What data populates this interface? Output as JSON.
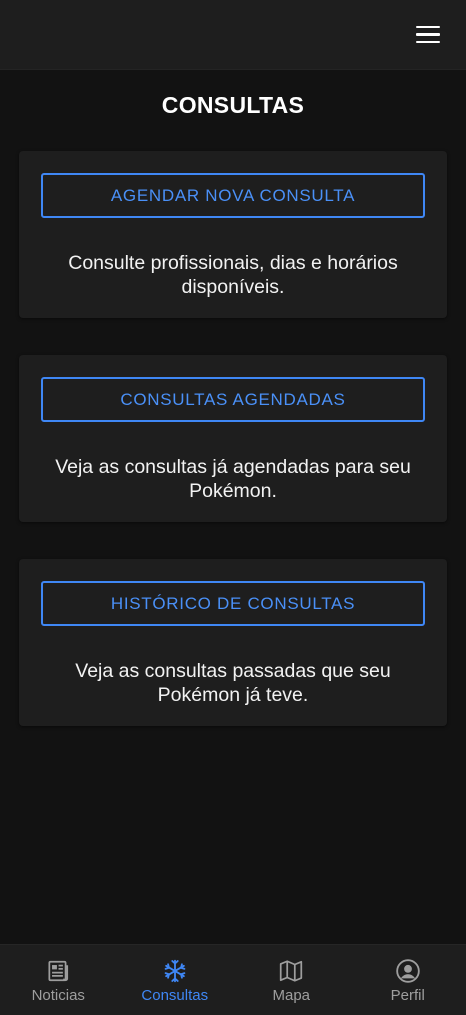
{
  "header": {
    "menu_icon": "hamburger-menu-icon"
  },
  "page": {
    "title": "CONSULTAS"
  },
  "cards": [
    {
      "button_label": "AGENDAR NOVA CONSULTA",
      "description": "Consulte profissionais, dias e horários disponíveis."
    },
    {
      "button_label": "CONSULTAS AGENDADAS",
      "description": "Veja as consultas já agendadas para seu Pokémon."
    },
    {
      "button_label": "HISTÓRICO DE CONSULTAS",
      "description": "Veja as consultas passadas que seu Pokémon já teve."
    }
  ],
  "bottom_nav": {
    "items": [
      {
        "label": "Noticias",
        "icon": "newspaper-icon",
        "active": false
      },
      {
        "label": "Consultas",
        "icon": "medical-star-icon",
        "active": true
      },
      {
        "label": "Mapa",
        "icon": "map-icon",
        "active": false
      },
      {
        "label": "Perfil",
        "icon": "user-circle-icon",
        "active": false
      }
    ]
  },
  "colors": {
    "background": "#121212",
    "surface": "#1e1e1e",
    "accent": "#3f87f5",
    "inactive": "#9e9e9e",
    "text": "#ffffff"
  }
}
